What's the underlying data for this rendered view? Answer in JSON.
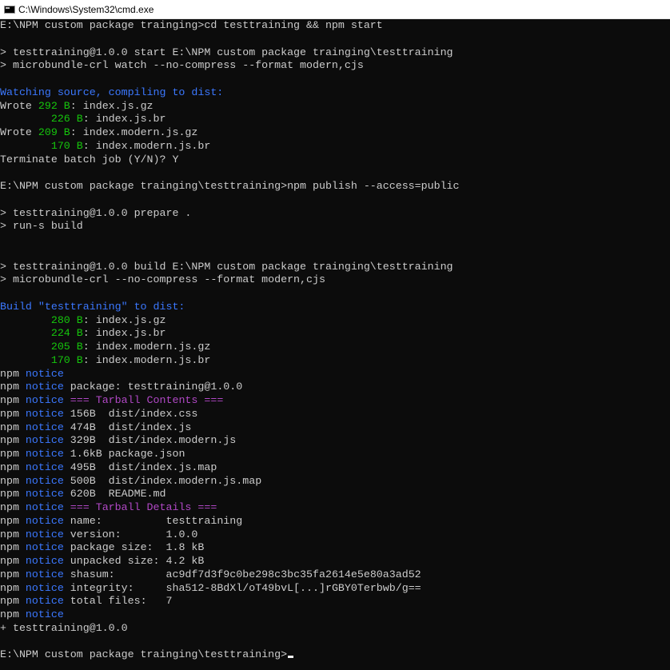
{
  "window": {
    "title": "C:\\Windows\\System32\\cmd.exe"
  },
  "console": {
    "lines": [
      [
        {
          "t": "E:\\NPM custom package trainging>cd testtraining && npm start"
        }
      ],
      [],
      [
        {
          "t": "> testtraining@1.0.0 start E:\\NPM custom package trainging\\testtraining"
        }
      ],
      [
        {
          "t": "> microbundle-crl watch --no-compress --format modern,cjs"
        }
      ],
      [],
      [
        {
          "t": "Watching source, compiling to dist:",
          "c": "b"
        }
      ],
      [
        {
          "t": "Wrote "
        },
        {
          "t": "292 B",
          "c": "g"
        },
        {
          "t": ": index.js.gz"
        }
      ],
      [
        {
          "t": "        "
        },
        {
          "t": "226 B",
          "c": "g"
        },
        {
          "t": ": index.js.br"
        }
      ],
      [
        {
          "t": "Wrote "
        },
        {
          "t": "209 B",
          "c": "g"
        },
        {
          "t": ": index.modern.js.gz"
        }
      ],
      [
        {
          "t": "        "
        },
        {
          "t": "170 B",
          "c": "g"
        },
        {
          "t": ": index.modern.js.br"
        }
      ],
      [
        {
          "t": "Terminate batch job (Y/N)? Y"
        }
      ],
      [],
      [
        {
          "t": "E:\\NPM custom package trainging\\testtraining>npm publish --access=public"
        }
      ],
      [],
      [
        {
          "t": "> testtraining@1.0.0 prepare ."
        }
      ],
      [
        {
          "t": "> run-s build"
        }
      ],
      [],
      [],
      [
        {
          "t": "> testtraining@1.0.0 build E:\\NPM custom package trainging\\testtraining"
        }
      ],
      [
        {
          "t": "> microbundle-crl --no-compress --format modern,cjs"
        }
      ],
      [],
      [
        {
          "t": "Build \"testtraining\" to dist:",
          "c": "b"
        }
      ],
      [
        {
          "t": "        "
        },
        {
          "t": "280 B",
          "c": "g"
        },
        {
          "t": ": index.js.gz"
        }
      ],
      [
        {
          "t": "        "
        },
        {
          "t": "224 B",
          "c": "g"
        },
        {
          "t": ": index.js.br"
        }
      ],
      [
        {
          "t": "        "
        },
        {
          "t": "205 B",
          "c": "g"
        },
        {
          "t": ": index.modern.js.gz"
        }
      ],
      [
        {
          "t": "        "
        },
        {
          "t": "170 B",
          "c": "g"
        },
        {
          "t": ": index.modern.js.br"
        }
      ],
      [
        {
          "t": "npm "
        },
        {
          "t": "notice",
          "c": "b"
        }
      ],
      [
        {
          "t": "npm "
        },
        {
          "t": "notice",
          "c": "b"
        },
        {
          "t": " package: testtraining@1.0.0"
        }
      ],
      [
        {
          "t": "npm "
        },
        {
          "t": "notice",
          "c": "b"
        },
        {
          "t": " === Tarball Contents ===",
          "c": "m"
        }
      ],
      [
        {
          "t": "npm "
        },
        {
          "t": "notice",
          "c": "b"
        },
        {
          "t": " 156B  dist/index.css"
        }
      ],
      [
        {
          "t": "npm "
        },
        {
          "t": "notice",
          "c": "b"
        },
        {
          "t": " 474B  dist/index.js"
        }
      ],
      [
        {
          "t": "npm "
        },
        {
          "t": "notice",
          "c": "b"
        },
        {
          "t": " 329B  dist/index.modern.js"
        }
      ],
      [
        {
          "t": "npm "
        },
        {
          "t": "notice",
          "c": "b"
        },
        {
          "t": " 1.6kB package.json"
        }
      ],
      [
        {
          "t": "npm "
        },
        {
          "t": "notice",
          "c": "b"
        },
        {
          "t": " 495B  dist/index.js.map"
        }
      ],
      [
        {
          "t": "npm "
        },
        {
          "t": "notice",
          "c": "b"
        },
        {
          "t": " 500B  dist/index.modern.js.map"
        }
      ],
      [
        {
          "t": "npm "
        },
        {
          "t": "notice",
          "c": "b"
        },
        {
          "t": " 620B  README.md"
        }
      ],
      [
        {
          "t": "npm "
        },
        {
          "t": "notice",
          "c": "b"
        },
        {
          "t": " === Tarball Details ===",
          "c": "m"
        }
      ],
      [
        {
          "t": "npm "
        },
        {
          "t": "notice",
          "c": "b"
        },
        {
          "t": " name:          testtraining"
        }
      ],
      [
        {
          "t": "npm "
        },
        {
          "t": "notice",
          "c": "b"
        },
        {
          "t": " version:       1.0.0"
        }
      ],
      [
        {
          "t": "npm "
        },
        {
          "t": "notice",
          "c": "b"
        },
        {
          "t": " package size:  1.8 kB"
        }
      ],
      [
        {
          "t": "npm "
        },
        {
          "t": "notice",
          "c": "b"
        },
        {
          "t": " unpacked size: 4.2 kB"
        }
      ],
      [
        {
          "t": "npm "
        },
        {
          "t": "notice",
          "c": "b"
        },
        {
          "t": " shasum:        ac9df7d3f9c0be298c3bc35fa2614e5e80a3ad52"
        }
      ],
      [
        {
          "t": "npm "
        },
        {
          "t": "notice",
          "c": "b"
        },
        {
          "t": " integrity:     sha512-8BdXl/oT49bvL[...]rGBY0Terbwb/g=="
        }
      ],
      [
        {
          "t": "npm "
        },
        {
          "t": "notice",
          "c": "b"
        },
        {
          "t": " total files:   7"
        }
      ],
      [
        {
          "t": "npm "
        },
        {
          "t": "notice",
          "c": "b"
        }
      ],
      [
        {
          "t": "+ testtraining@1.0.0"
        }
      ],
      [],
      [
        {
          "t": "E:\\NPM custom package trainging\\testtraining>"
        }
      ]
    ]
  },
  "colors": {
    "background": "#0c0c0c",
    "foreground": "#cccccc",
    "green": "#16c60c",
    "blue": "#3b78ff",
    "magenta": "#b148c6"
  },
  "icons": {
    "window_icon": "cmd-icon"
  }
}
